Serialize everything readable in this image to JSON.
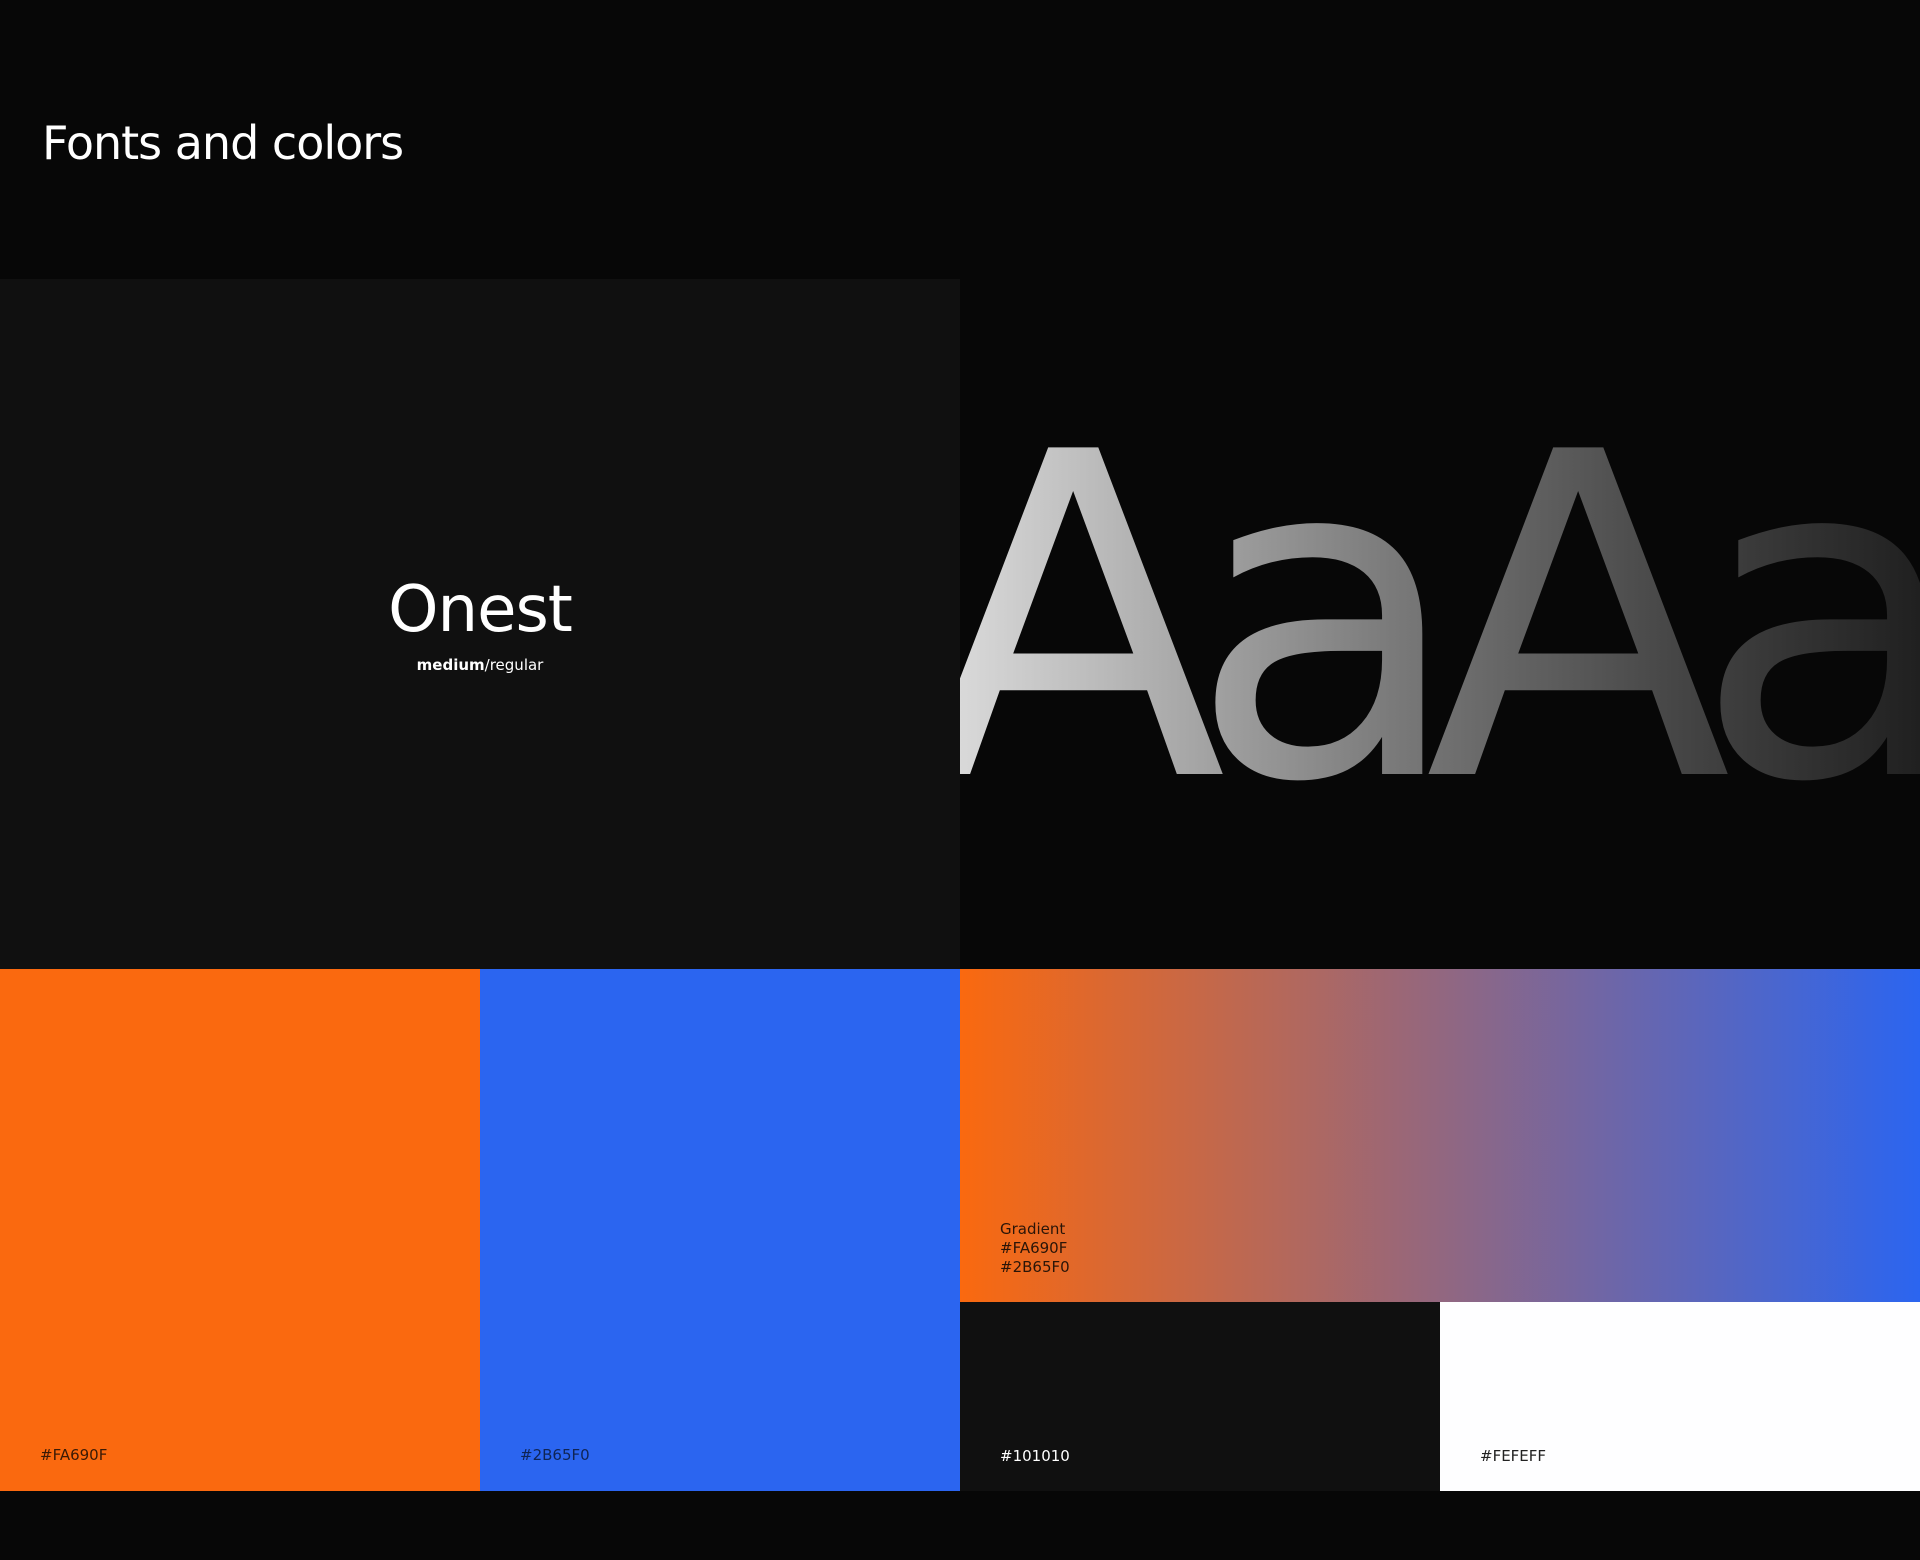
{
  "page": {
    "title": "Fonts and colors"
  },
  "font": {
    "name": "Onest",
    "weight_primary": "medium",
    "separator": "/",
    "weight_secondary": "regular",
    "specimen_text": "AaAa"
  },
  "colors": {
    "orange": {
      "hex": "#FA690F",
      "label": "#FA690F"
    },
    "blue": {
      "hex": "#2B65F0",
      "label": "#2B65F0"
    },
    "gradient": {
      "title": "Gradient",
      "stop_1": "#FA690F",
      "stop_2": "#2B65F0"
    },
    "dark": {
      "hex": "#101010",
      "label": "#101010"
    },
    "light": {
      "hex": "#FEFEFF",
      "label": "#FEFEFF"
    }
  }
}
